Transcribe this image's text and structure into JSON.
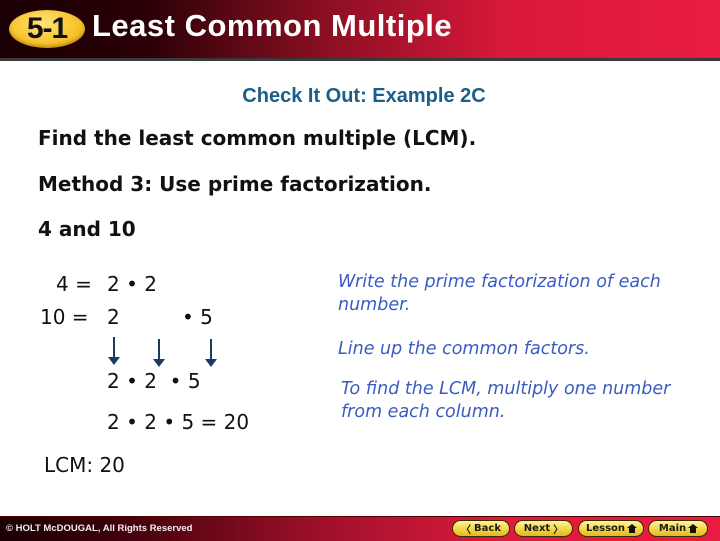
{
  "header": {
    "lesson_number": "5-1",
    "title": "Least Common Multiple"
  },
  "content": {
    "subtitle": "Check It Out: Example 2C",
    "instruction": "Find the least common multiple (LCM).",
    "method": "Method 3: Use prime factorization.",
    "numbers": "4 and 10",
    "factorization": {
      "row1_label": "4 = ",
      "row1_factors": "2 • 2",
      "row2_label": "10 = ",
      "row2_factor_a": "2",
      "row2_factor_b": "• 5",
      "lined_up": "2 • 2  • 5",
      "product": "2 • 2 • 5 = 20",
      "result": "LCM: 20"
    },
    "notes": [
      "Write the prime factorization of each number.",
      "Line up the common factors.",
      "To find the LCM, multiply one number from each column."
    ]
  },
  "footer": {
    "copyright": "© HOLT McDOUGAL, All Rights Reserved",
    "nav": {
      "back": "Back",
      "next": "Next",
      "lesson": "Lesson",
      "main": "Main",
      "back_glyph": "〈",
      "next_glyph": "〉"
    }
  },
  "colors": {
    "subtitle": "#1a5e8a",
    "notes": "#3a5cc2",
    "badge": "#f7c52e",
    "header_red": "#ea1c42"
  }
}
